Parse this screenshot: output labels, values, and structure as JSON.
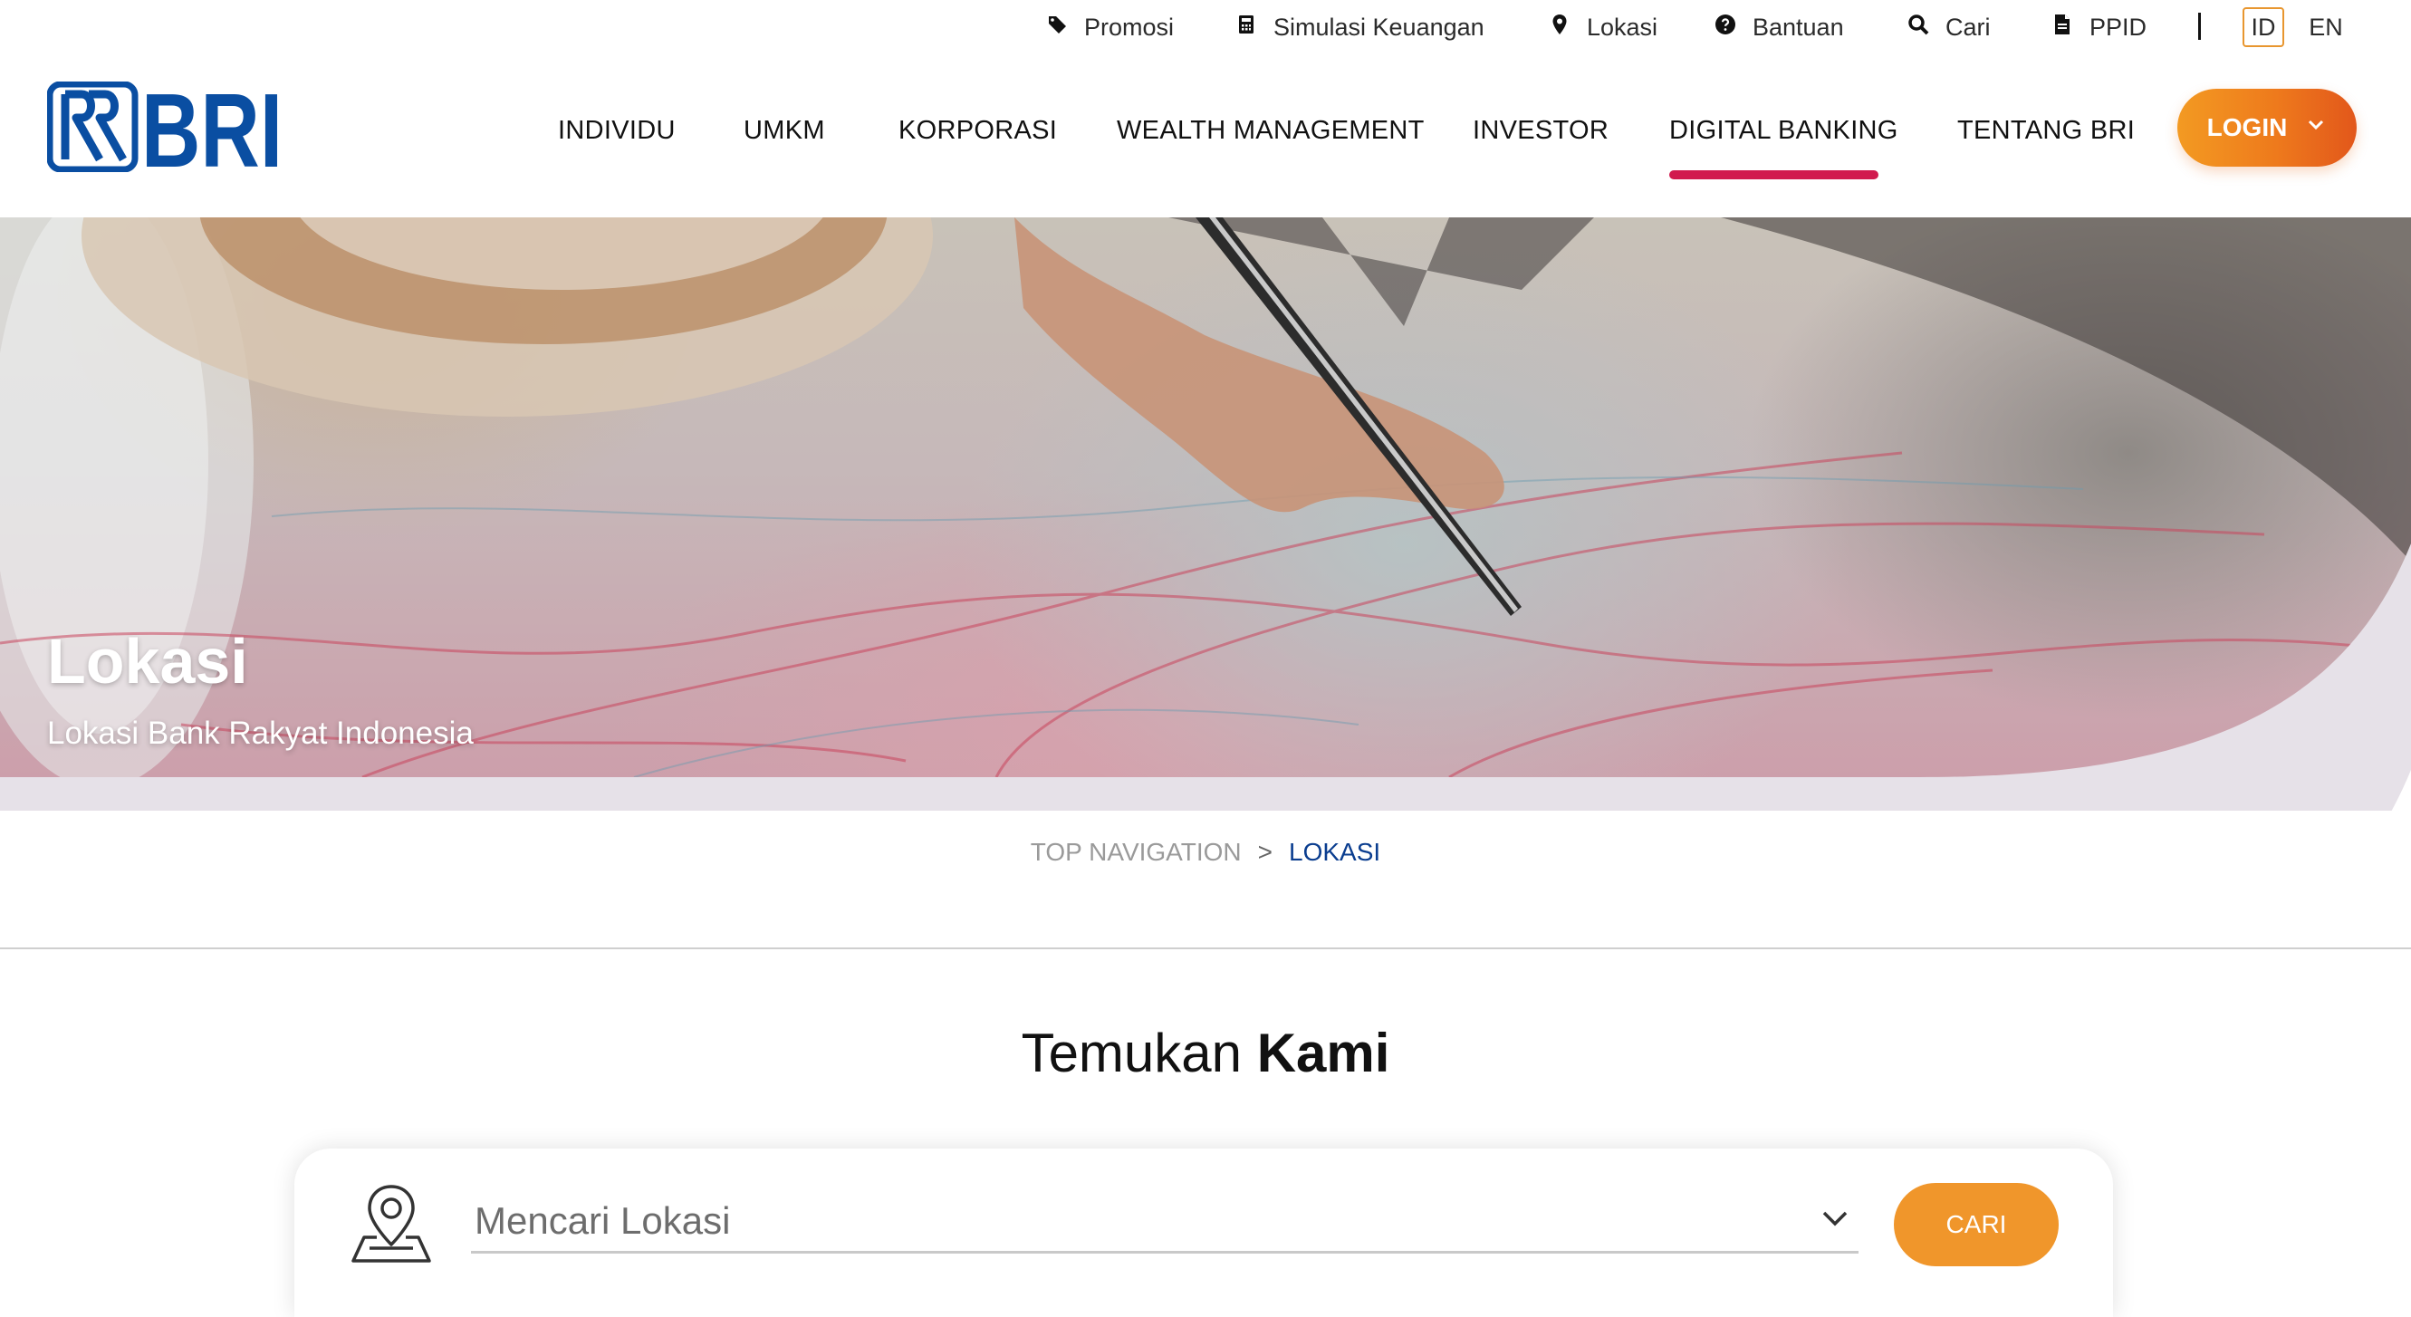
{
  "utility_nav": {
    "items": [
      {
        "label": "Promosi",
        "icon": "tag-icon"
      },
      {
        "label": "Simulasi Keuangan",
        "icon": "calculator-icon"
      },
      {
        "label": "Lokasi",
        "icon": "map-pin-icon"
      },
      {
        "label": "Bantuan",
        "icon": "help-circle-icon"
      },
      {
        "label": "Cari",
        "icon": "search-icon"
      },
      {
        "label": "PPID",
        "icon": "document-icon"
      }
    ],
    "languages": {
      "active": "ID",
      "other": "EN"
    }
  },
  "brand": {
    "name": "BRI",
    "primary_color": "#0a4ea2"
  },
  "main_nav": {
    "items": [
      "INDIVIDU",
      "UMKM",
      "KORPORASI",
      "WEALTH MANAGEMENT",
      "INVESTOR",
      "DIGITAL BANKING",
      "TENTANG BRI"
    ],
    "active": "DIGITAL BANKING",
    "active_color": "#d11a4e",
    "login_label": "LOGIN"
  },
  "hero": {
    "title": "Lokasi",
    "subtitle": "Lokasi Bank Rakyat Indonesia"
  },
  "breadcrumb": {
    "items": [
      "TOP NAVIGATION",
      "LOKASI"
    ],
    "separator": ">"
  },
  "find_section": {
    "title_regular": "Temukan ",
    "title_bold": "Kami",
    "search_placeholder": "Mencari Lokasi",
    "search_button": "CARI",
    "accent_color": "#f0962b"
  }
}
